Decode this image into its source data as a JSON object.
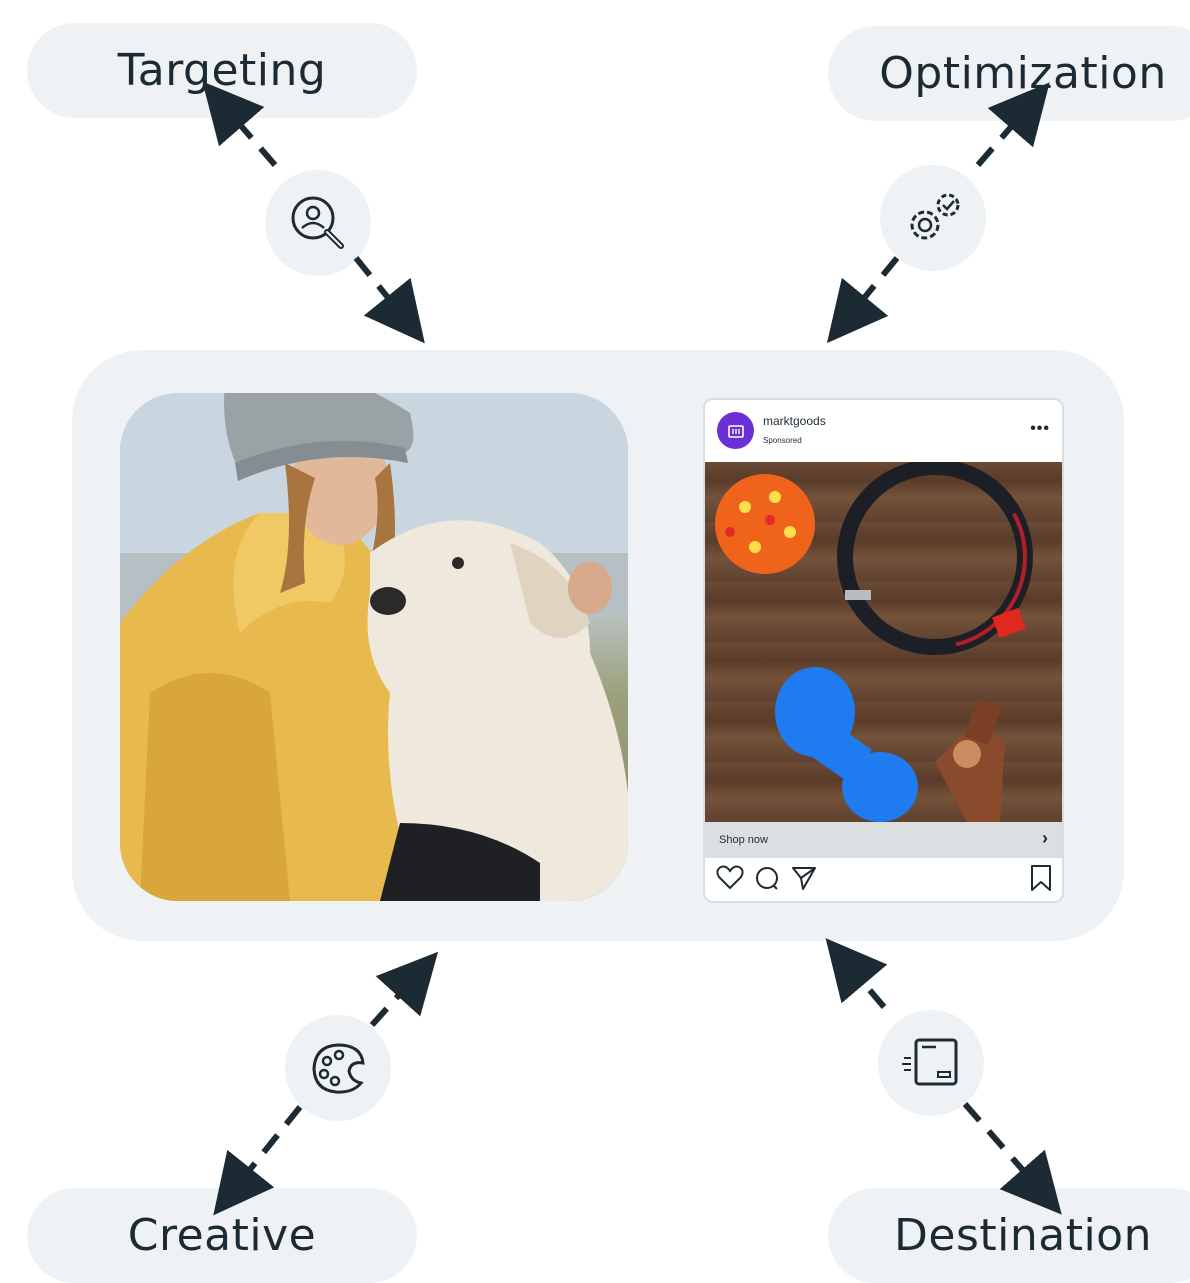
{
  "labels": {
    "targeting": "Targeting",
    "optimization": "Optimization",
    "creative": "Creative",
    "destination": "Destination"
  },
  "ad": {
    "account": "marktgoods",
    "sponsored": "Sponsored",
    "cta": "Shop now",
    "more": "•••"
  },
  "colors": {
    "pill_bg": "#eef2f5",
    "arrow": "#1c2b33",
    "avatar": "#6b2fd6"
  },
  "icons": [
    "search-person-icon",
    "gears-icon",
    "palette-icon",
    "browser-window-icon",
    "heart-icon",
    "comment-icon",
    "share-icon",
    "bookmark-icon",
    "chevron-right-icon"
  ]
}
